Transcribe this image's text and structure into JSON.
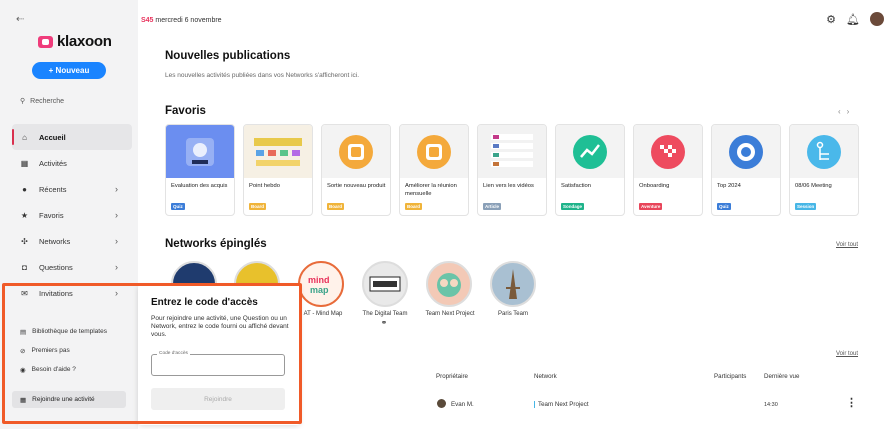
{
  "sidebar": {
    "brand": "klaxoon",
    "new_button": "+ Nouveau",
    "search": "Recherche",
    "items": [
      {
        "label": "Accueil",
        "icon": "home-icon",
        "glyph": "⌂"
      },
      {
        "label": "Activités",
        "icon": "grid-icon",
        "glyph": "▦"
      },
      {
        "label": "Récents",
        "icon": "clock-icon",
        "glyph": "●"
      },
      {
        "label": "Favoris",
        "icon": "star-icon",
        "glyph": "★"
      },
      {
        "label": "Networks",
        "icon": "network-icon",
        "glyph": "✣"
      },
      {
        "label": "Questions",
        "icon": "question-icon",
        "glyph": "◘"
      },
      {
        "label": "Invitations",
        "icon": "mail-icon",
        "glyph": "✉"
      }
    ],
    "bottom": [
      {
        "label": "Bibliothèque de templates",
        "glyph": "▤"
      },
      {
        "label": "Premiers pas",
        "glyph": "⊘"
      },
      {
        "label": "Besoin d'aide ?",
        "glyph": "◉"
      }
    ],
    "join": "Rejoindre une activité"
  },
  "header": {
    "week": "S45",
    "date": "mercredi 6 novembre"
  },
  "publications": {
    "title": "Nouvelles publications",
    "subtitle": "Les nouvelles activités publiées dans vos Networks s'afficheront ici."
  },
  "favorites": {
    "title": "Favoris",
    "cards": [
      {
        "label": "Evaluation des acquis",
        "badge": "Quiz",
        "badge_color": "#3b7dd8",
        "bg": "#6b8ef0"
      },
      {
        "label": "Point hebdo",
        "badge": "Board",
        "badge_color": "#f0b43a",
        "bg": "#f6f0e4"
      },
      {
        "label": "Sortie nouveau produit",
        "badge": "Board",
        "badge_color": "#f0b43a",
        "bg": "#f4a93b"
      },
      {
        "label": "Améliorer la réunion mensuelle",
        "badge": "Board",
        "badge_color": "#f0b43a",
        "bg": "#f4a93b"
      },
      {
        "label": "Lien vers les vidéos",
        "badge": "Article",
        "badge_color": "#8aa0b8",
        "bg": "#f2f2f2"
      },
      {
        "label": "Satisfaction",
        "badge": "Sondage",
        "badge_color": "#1eb38a",
        "bg": "#1fbf95"
      },
      {
        "label": "Onboarding",
        "badge": "Aventure",
        "badge_color": "#e8455a",
        "bg": "#ee4b5f"
      },
      {
        "label": "Top 2024",
        "badge": "Quiz",
        "badge_color": "#3b7dd8",
        "bg": "#3b7dd8"
      },
      {
        "label": "08/06 Meeting",
        "badge": "Session",
        "badge_color": "#47b6e6",
        "bg": "#4ab8ea"
      }
    ]
  },
  "networks": {
    "title": "Networks épinglés",
    "see_all": "Voir tout",
    "items": [
      {
        "label": "",
        "bg": "#1f3b6e"
      },
      {
        "label": "",
        "bg": "#e8c12c"
      },
      {
        "label": "AT - Mind Map",
        "bg": "#fff2ea"
      },
      {
        "label": "The Digital Team",
        "bg": "#e9e9e9"
      },
      {
        "label": "Team Next Project",
        "bg": "#f3c9b6"
      },
      {
        "label": "Paris Team",
        "bg": "#a9c0d2"
      }
    ]
  },
  "table": {
    "see_all": "Voir tout",
    "headers": [
      "Propriétaire",
      "Network",
      "Participants",
      "Dernière vue"
    ],
    "row": {
      "owner": "Evan M.",
      "network": "Team Next Project",
      "last_seen": "14:30"
    }
  },
  "popover": {
    "title": "Entrez le code d'accès",
    "description": "Pour rejoindre une activité, une Question ou un Network, entrez le code fourni ou affiché devant vous.",
    "field_label": "Code d'accès",
    "field_value": "",
    "button": "Rejoindre"
  },
  "colors": {
    "accent": "#1a84ff",
    "brand": "#ef3c7b",
    "highlight": "#f05a28"
  }
}
